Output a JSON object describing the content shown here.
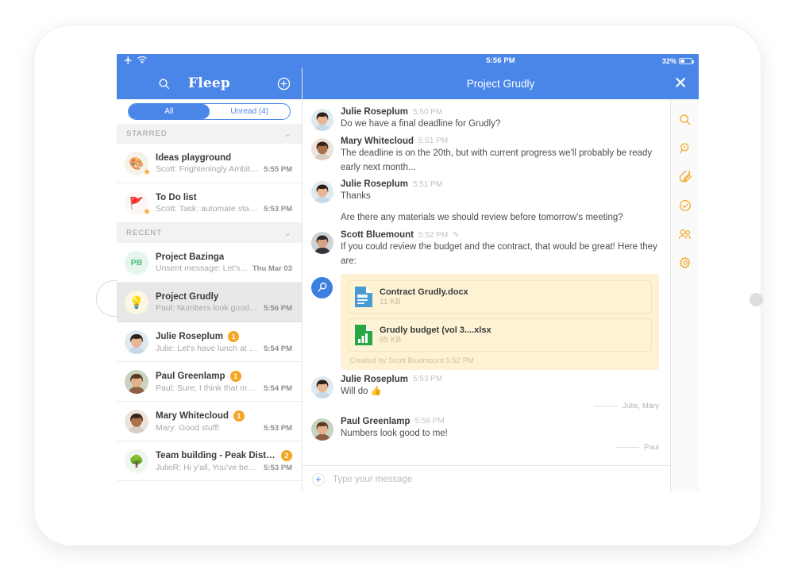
{
  "device": {
    "status_bar": {
      "airplane_icon": "airplane-icon",
      "wifi_icon": "wifi-icon",
      "time": "5:56 PM",
      "battery_percent": "32%"
    }
  },
  "sidebar": {
    "header": {
      "menu_icon": "hamburger-icon",
      "search_icon": "search-icon",
      "brand": "Fleep",
      "add_icon": "plus-circle-icon"
    },
    "filter": {
      "all_label": "All",
      "unread_label": "Unread (4)",
      "active": "All"
    },
    "sections": [
      {
        "title": "STARRED",
        "items": [
          {
            "avatar_glyph": "🎨",
            "avatar_bg": "#f7f2e8",
            "avatar_kind": "emoji",
            "starred": true,
            "title": "Ideas playground",
            "snippet": "Scott: Frighteningly Ambiti...",
            "time": "5:55 PM",
            "unread": "",
            "selected": false
          },
          {
            "avatar_glyph": "🚩",
            "avatar_bg": "#fdf6f3",
            "avatar_kind": "emoji",
            "starred": true,
            "title": "To Do list",
            "snippet": "Scott: Task: automate stats...",
            "time": "5:53 PM",
            "unread": "",
            "selected": false
          }
        ]
      },
      {
        "title": "RECENT",
        "items": [
          {
            "avatar_glyph": "PB",
            "avatar_bg": "#e6f6ec",
            "avatar_fg": "#4ec07d",
            "avatar_kind": "initials",
            "starred": false,
            "title": "Project Bazinga",
            "snippet": "Unsent message: Let's...",
            "time": "Thu Mar 03",
            "unread": "",
            "selected": false
          },
          {
            "avatar_glyph": "💡",
            "avatar_bg": "#fdf6e3",
            "avatar_kind": "emoji",
            "starred": false,
            "title": "Project Grudly",
            "snippet": "Paul: Numbers look good t...",
            "time": "5:56 PM",
            "unread": "",
            "selected": true
          },
          {
            "avatar_glyph": "",
            "avatar_kind": "photo-julie",
            "starred": false,
            "title": "Julie Roseplum",
            "snippet": "Julie: Let's have lunch at th...",
            "time": "5:54 PM",
            "unread": "1",
            "selected": false
          },
          {
            "avatar_glyph": "",
            "avatar_kind": "photo-paul",
            "starred": false,
            "title": "Paul Greenlamp",
            "snippet": "Paul: Sure, I think that mak...",
            "time": "5:54 PM",
            "unread": "1",
            "selected": false
          },
          {
            "avatar_glyph": "",
            "avatar_kind": "photo-mary",
            "starred": false,
            "title": "Mary Whitecloud",
            "snippet": "Mary: Good stuff!",
            "time": "5:53 PM",
            "unread": "1",
            "selected": false
          },
          {
            "avatar_glyph": "🌳",
            "avatar_bg": "#eef7ee",
            "avatar_kind": "emoji",
            "starred": false,
            "title": "Team building - Peak District",
            "snippet": "JulieR: Hi y'all, You've been...",
            "time": "5:53 PM",
            "unread": "2",
            "selected": false
          }
        ]
      }
    ]
  },
  "conversation": {
    "title": "Project Grudly",
    "close_icon": "close-icon",
    "messages": [
      {
        "kind": "message",
        "author": "Julie Roseplum",
        "time": "5:50 PM",
        "avatar": "photo-julie",
        "text": "Do we have a final deadline for Grudly?",
        "extra_text": "",
        "edited": false
      },
      {
        "kind": "message",
        "author": "Mary Whitecloud",
        "time": "5:51 PM",
        "avatar": "photo-mary",
        "text": "The deadline is on the 20th, but with current progress we'll probably be ready early next month...",
        "extra_text": "",
        "edited": false
      },
      {
        "kind": "message",
        "author": "Julie Roseplum",
        "time": "5:51 PM",
        "avatar": "photo-julie",
        "text": "Thanks",
        "extra_text": "Are there any materials we should review before tomorrow's meeting?",
        "edited": false
      },
      {
        "kind": "message",
        "author": "Scott Bluemount",
        "time": "5:52 PM",
        "avatar": "photo-scott",
        "text": "If you could review the budget and the contract, that would be great! Here they are:",
        "extra_text": "",
        "edited": true
      }
    ],
    "pinned_card": {
      "pin_icon": "pin-icon",
      "files": [
        {
          "name": "Contract Grudly.docx",
          "size": "11 KB",
          "type": "docx",
          "color": "#4a9ad4"
        },
        {
          "name": "Grudly budget (vol 3....xlsx",
          "size": "65 KB",
          "type": "xlsx",
          "color": "#28a745"
        }
      ],
      "created_by": "Created by Scott Bluemount 5:52 PM"
    },
    "tail_messages": [
      {
        "author": "Julie Roseplum",
        "time": "5:53 PM",
        "avatar": "photo-julie",
        "text": "Will do 👍",
        "receipt": "Julie, Mary"
      },
      {
        "author": "Paul Greenlamp",
        "time": "5:56 PM",
        "avatar": "photo-paul",
        "text": "Numbers look good to me!",
        "receipt": "Paul"
      }
    ],
    "composer": {
      "add_icon": "plus-icon",
      "placeholder": "Type your message",
      "value": ""
    }
  },
  "icon_rail": {
    "color": "#f5a623",
    "items": [
      {
        "name": "search-icon"
      },
      {
        "name": "pinboard-icon"
      },
      {
        "name": "attachment-icon"
      },
      {
        "name": "tasks-icon"
      },
      {
        "name": "members-icon"
      },
      {
        "name": "settings-icon"
      }
    ]
  }
}
